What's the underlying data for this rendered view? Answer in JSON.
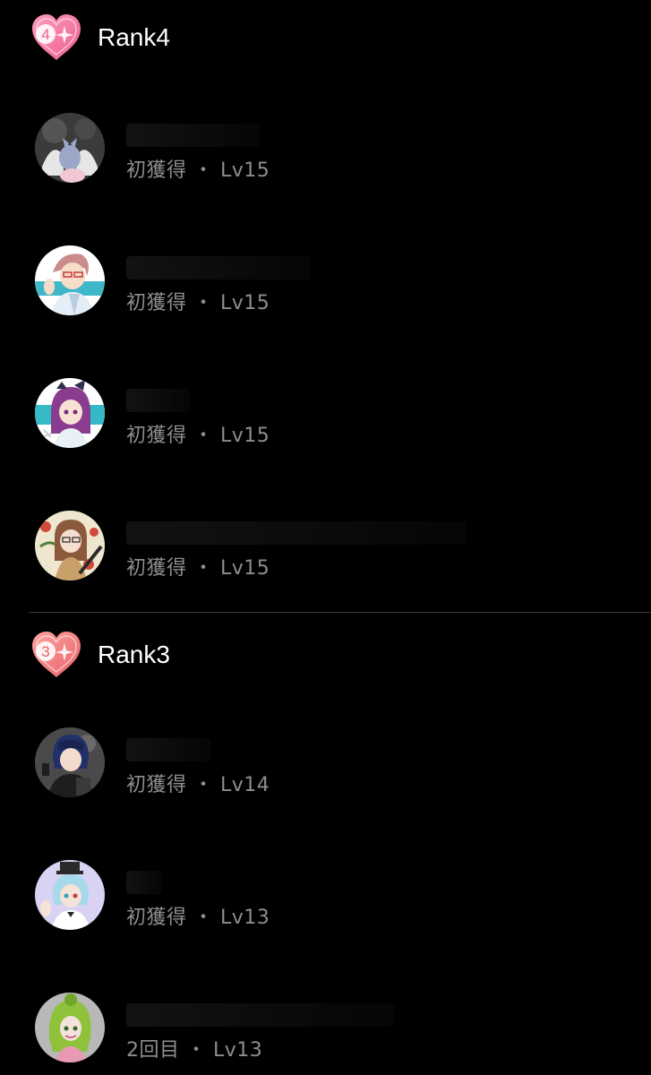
{
  "sections": [
    {
      "title": "Rank4",
      "badge_number": "4",
      "members": [
        {
          "status": "初獲得",
          "level": "Lv15"
        },
        {
          "status": "初獲得",
          "level": "Lv15"
        },
        {
          "status": "初獲得",
          "level": "Lv15"
        },
        {
          "status": "初獲得",
          "level": "Lv15"
        }
      ]
    },
    {
      "title": "Rank3",
      "badge_number": "3",
      "members": [
        {
          "status": "初獲得",
          "level": "Lv14"
        },
        {
          "status": "初獲得",
          "level": "Lv13"
        },
        {
          "status": "2回目",
          "level": "Lv13"
        }
      ]
    }
  ],
  "separator": "・",
  "colors": {
    "background": "#000000",
    "badge_pink": "#f37aa0",
    "badge_coral": "#ee7a7c",
    "meta_text": "#8d8d8d",
    "title_text": "#ffffff",
    "divider": "#3a3a3a"
  }
}
